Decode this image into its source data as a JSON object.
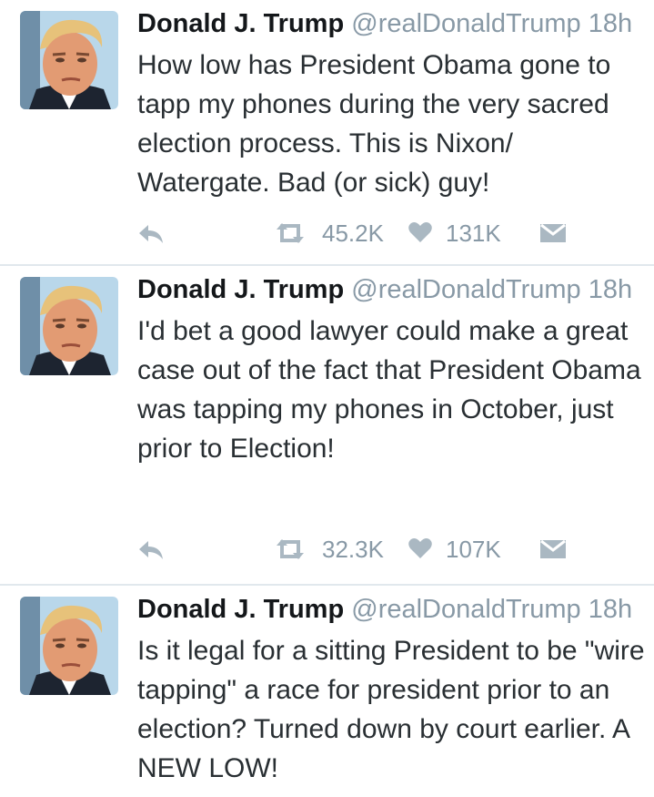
{
  "tweets": [
    {
      "name": "Donald J. Trump",
      "handle": "@realDonaldTrump",
      "time": "18h",
      "text": "How low has President Obama gone to tapp my phones during the very sacred election process. This is Nixon/ Watergate. Bad (or sick) guy!",
      "retweets": "45.2K",
      "likes": "131K"
    },
    {
      "name": "Donald J. Trump",
      "handle": "@realDonaldTrump",
      "time": "18h",
      "text": "I'd bet a good lawyer could make a great case out of the fact that President Obama was tapping my phones in October, just prior to Election!",
      "retweets": "32.3K",
      "likes": "107K"
    },
    {
      "name": "Donald J. Trump",
      "handle": "@realDonaldTrump",
      "time": "18h",
      "text": "Is it legal for a sitting President to be \"wire tapping\" a race for president prior to an election? Turned down by court earlier. A NEW LOW!"
    }
  ],
  "icons": {
    "reply": "reply-icon",
    "retweet": "retweet-icon",
    "like": "heart-icon",
    "dm": "envelope-icon"
  },
  "colors": {
    "name": "#14171a",
    "muted": "#8899a6",
    "text": "#292f33",
    "divider": "#e1e8ed"
  }
}
